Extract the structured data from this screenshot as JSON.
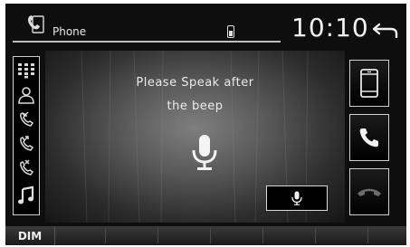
{
  "header": {
    "title": "Phone",
    "clock": "10:10",
    "icons": [
      "phone-icon",
      "signal-icon",
      "back-icon"
    ]
  },
  "sidebar": {
    "items": [
      {
        "icon": "keypad-icon"
      },
      {
        "icon": "contacts-icon"
      },
      {
        "icon": "incoming-call-icon"
      },
      {
        "icon": "outgoing-call-icon"
      },
      {
        "icon": "missed-call-icon"
      },
      {
        "icon": "music-icon"
      }
    ]
  },
  "main": {
    "prompt_line1": "Please Speak after",
    "prompt_line2": "the beep",
    "icons": [
      "microphone-icon",
      "voice-button-microphone-icon"
    ]
  },
  "right_buttons": [
    {
      "icon": "handset-device-icon"
    },
    {
      "icon": "call-accept-icon"
    },
    {
      "icon": "call-end-icon"
    }
  ],
  "bottom_bar": {
    "dim_label": "DIM"
  },
  "colors": {
    "background": "#0e0e0e",
    "text": "#ececec",
    "border": "#cfcfcf"
  }
}
